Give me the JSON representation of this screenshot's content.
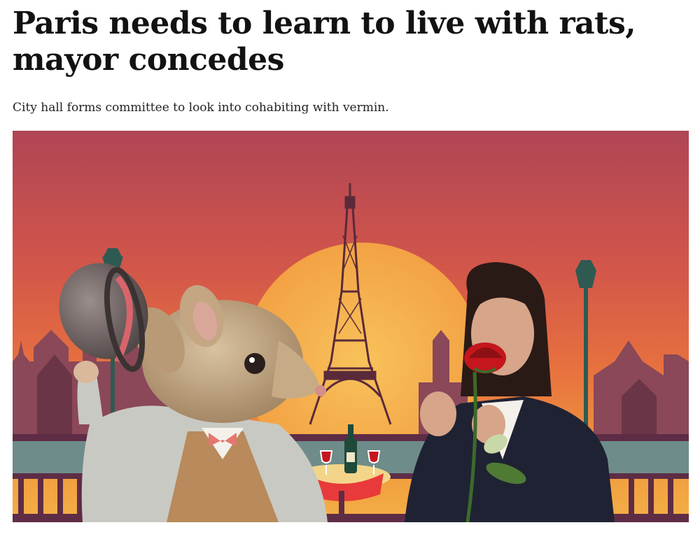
{
  "article": {
    "headline": "Paris needs to learn to live with rats, mayor concedes",
    "standfirst": "City hall forms committee to look into cohabiting with vermin."
  },
  "hero_image": {
    "colors": {
      "sky_top": "#b04555",
      "sky_mid": "#e0603f",
      "sky_low": "#f0a040",
      "sun": "#f6b24a",
      "skyline": "#8a4858",
      "skyline_dark": "#6b3548",
      "tower": "#5a2a3a",
      "promenade": "#6e8c8a",
      "railing": "#5e2c45",
      "table_cloth": "#e83a3a",
      "rose": "#c4161c"
    }
  }
}
